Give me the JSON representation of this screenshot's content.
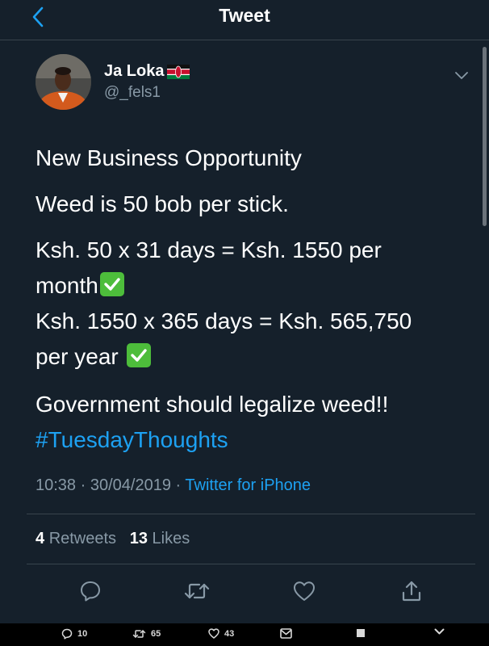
{
  "header": {
    "title": "Tweet"
  },
  "author": {
    "name": "Ja Loka",
    "handle": "@_fels1"
  },
  "tweet": {
    "line1": "New Business Opportunity",
    "line2": "Weed is 50 bob per stick.",
    "line3a": "Ksh. 50 x 31 days = Ksh. 1550 per",
    "line3b": "month",
    "line4a": "Ksh. 1550 x 365 days = Ksh. 565,750",
    "line4b": "per year",
    "line5": "Government should legalize weed!!",
    "hashtag": "#TuesdayThoughts"
  },
  "meta": {
    "time": "10:38",
    "sep1": "·",
    "date": "30/04/2019",
    "sep2": "·",
    "source": "Twitter for iPhone"
  },
  "stats": {
    "retweets_count": "4",
    "retweets_label": "Retweets",
    "likes_count": "13",
    "likes_label": "Likes"
  },
  "bottom_bar": {
    "replies": "10",
    "retweets": "65",
    "likes": "43"
  },
  "icons": [
    "back-arrow-icon",
    "kenya-flag-icon",
    "chevron-down-icon",
    "check-mark-icon",
    "reply-icon",
    "retweet-icon",
    "like-icon",
    "share-icon",
    "mail-icon",
    "square-icon"
  ],
  "colors": {
    "background": "#15202b",
    "accent": "#1da1f2",
    "muted": "#8899a6",
    "check": "#4dbd3b"
  }
}
